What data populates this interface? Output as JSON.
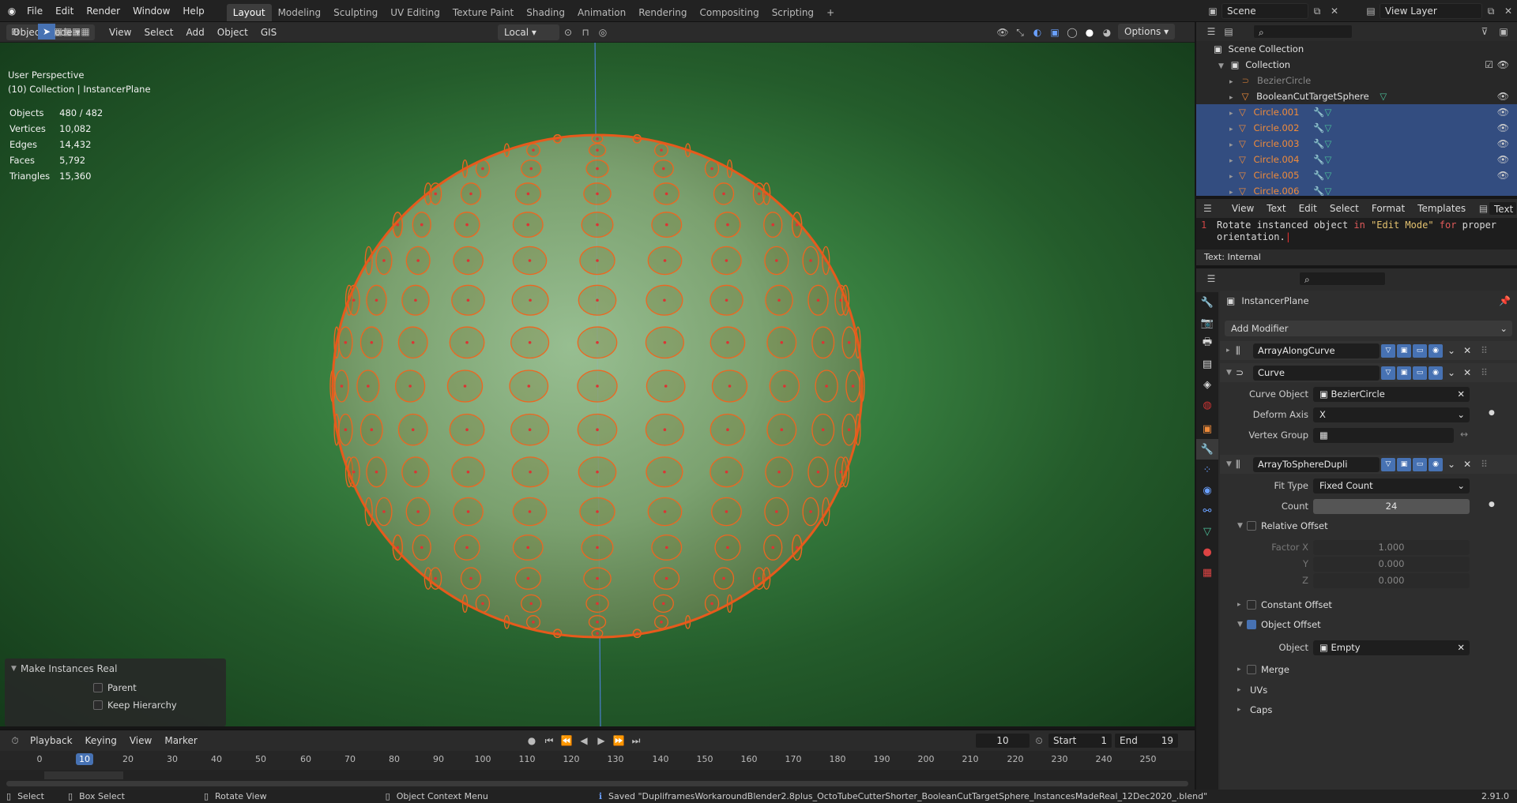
{
  "topbar": {
    "menus": [
      "File",
      "Edit",
      "Render",
      "Window",
      "Help"
    ],
    "workspaces": [
      "Layout",
      "Modeling",
      "Sculpting",
      "UV Editing",
      "Texture Paint",
      "Shading",
      "Animation",
      "Rendering",
      "Compositing",
      "Scripting"
    ],
    "active_workspace": "Layout",
    "add_tab": "+",
    "scene": "Scene",
    "view_layer": "View Layer"
  },
  "tool_header": {
    "transform_orientation": "Local",
    "options": "Options"
  },
  "viewport_header": {
    "mode": "Object Mode",
    "menus": [
      "View",
      "Select",
      "Add",
      "Object",
      "GIS"
    ]
  },
  "viewport": {
    "perspective": "User Perspective",
    "collection": "(10) Collection | InstancerPlane",
    "stats": [
      {
        "label": "Objects",
        "value": "480 / 482"
      },
      {
        "label": "Vertices",
        "value": "10,082"
      },
      {
        "label": "Edges",
        "value": "14,432"
      },
      {
        "label": "Faces",
        "value": "5,792"
      },
      {
        "label": "Triangles",
        "value": "15,360"
      }
    ]
  },
  "operator_panel": {
    "title": "Make Instances Real",
    "options": [
      {
        "label": "Parent",
        "checked": false
      },
      {
        "label": "Keep Hierarchy",
        "checked": false
      }
    ]
  },
  "timeline": {
    "menus": [
      "Playback",
      "Keying",
      "View",
      "Marker"
    ],
    "current_frame": "10",
    "start_label": "Start",
    "start": "1",
    "end_label": "End",
    "end": "19",
    "ticks": [
      "0",
      "10",
      "20",
      "40",
      "50",
      "60",
      "70",
      "80",
      "90",
      "100",
      "110",
      "120",
      "130",
      "140",
      "150",
      "160",
      "170",
      "180",
      "190",
      "200",
      "210",
      "220",
      "230",
      "240",
      "250"
    ]
  },
  "statusbar": {
    "select": "Select",
    "box_select": "Box Select",
    "rotate_view": "Rotate View",
    "context_menu": "Object Context Menu",
    "message": "Saved \"DupliframesWorkaroundBlender2.8plus_OctoTubeCutterShorter_BooleanCutTargetSphere_InstancesMadeReal_12Dec2020_.blend\"",
    "version": "2.91.0"
  },
  "outliner": {
    "scene_collection": "Scene Collection",
    "collection": "Collection",
    "items": [
      {
        "name": "BezierCircle",
        "selected": false,
        "dim": true
      },
      {
        "name": "BooleanCutTargetSphere",
        "selected": false,
        "dim": false
      },
      {
        "name": "Circle.001",
        "selected": true,
        "dim": false
      },
      {
        "name": "Circle.002",
        "selected": true,
        "dim": false
      },
      {
        "name": "Circle.003",
        "selected": true,
        "dim": false
      },
      {
        "name": "Circle.004",
        "selected": true,
        "dim": false
      },
      {
        "name": "Circle.005",
        "selected": true,
        "dim": false
      },
      {
        "name": "Circle.006",
        "selected": true,
        "dim": false
      }
    ]
  },
  "text_editor": {
    "menus": [
      "View",
      "Text",
      "Edit",
      "Select",
      "Format",
      "Templates"
    ],
    "text_label": "Text",
    "line_number": "1",
    "code_a": "Rotate instanced object ",
    "code_kw1": "in",
    "code_str": " \"Edit Mode\" ",
    "code_kw2": "for",
    "code_b": " proper",
    "code_line2": "orientation.",
    "footer": "Text: Internal"
  },
  "properties": {
    "object_name": "InstancerPlane",
    "add_modifier": "Add Modifier",
    "modifiers": {
      "array_along_curve": "ArrayAlongCurve",
      "curve": "Curve",
      "array_to_sphere": "ArrayToSphereDupli"
    },
    "curve_object_label": "Curve Object",
    "curve_object": "BezierCircle",
    "deform_axis_label": "Deform Axis",
    "deform_axis": "X",
    "vertex_group_label": "Vertex Group",
    "fit_type_label": "Fit Type",
    "fit_type": "Fixed Count",
    "count_label": "Count",
    "count": "24",
    "relative_offset": "Relative Offset",
    "factor_x_label": "Factor X",
    "factor_x": "1.000",
    "y_label": "Y",
    "y": "0.000",
    "z_label": "Z",
    "z": "0.000",
    "constant_offset": "Constant Offset",
    "object_offset": "Object Offset",
    "object_label": "Object",
    "object": "Empty",
    "merge": "Merge",
    "uvs": "UVs",
    "caps": "Caps"
  },
  "colors": {
    "accent": "#4772b3",
    "selection_orange": "#f08b3a",
    "viewport_green": "#3a8342"
  }
}
